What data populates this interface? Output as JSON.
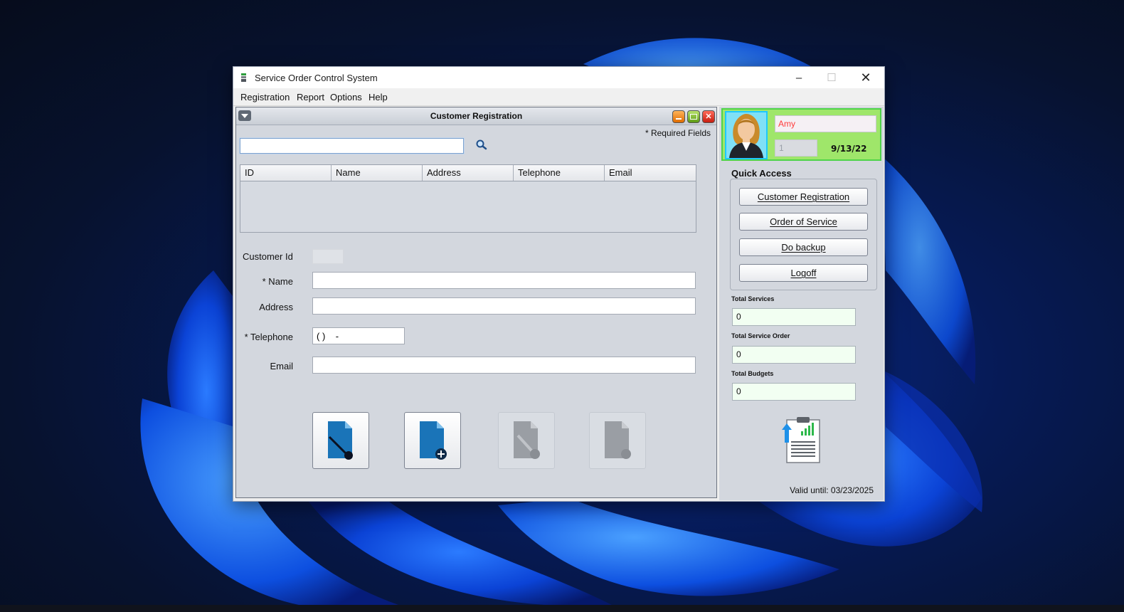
{
  "window": {
    "title": "Service Order Control System",
    "controls": {
      "minimize": "–",
      "maximize": "☐",
      "close": "✕"
    }
  },
  "menu": [
    "Registration",
    "Report",
    "Options",
    "Help"
  ],
  "form_window": {
    "title": "Customer Registration",
    "required_note": "* Required Fields",
    "search": {
      "value": "",
      "icon": "search-icon"
    },
    "table": {
      "columns": [
        "ID",
        "Name",
        "Address",
        "Telephone",
        "Email"
      ],
      "rows": []
    },
    "fields": {
      "customer_id": {
        "label": "Customer Id",
        "value": ""
      },
      "name": {
        "label": "* Name",
        "value": ""
      },
      "address": {
        "label": "Address",
        "value": ""
      },
      "telephone": {
        "label": "* Telephone",
        "value": "( )    -"
      },
      "email": {
        "label": "Email",
        "value": ""
      }
    },
    "actions": [
      {
        "icon": "clear-document-icon",
        "enabled": true
      },
      {
        "icon": "add-document-icon",
        "enabled": true
      },
      {
        "icon": "edit-document-icon",
        "enabled": false
      },
      {
        "icon": "delete-document-icon",
        "enabled": false
      }
    ]
  },
  "user": {
    "name": "Amy",
    "id": "1",
    "date": "9/13/22"
  },
  "quick_access": {
    "title": "Quick Access",
    "buttons": [
      "Customer Registration",
      "Order of Service",
      "Do backup",
      "Logoff"
    ]
  },
  "stats": [
    {
      "label": "Total Services",
      "value": "0"
    },
    {
      "label": "Total Service Order",
      "value": "0"
    },
    {
      "label": "Total Budgets",
      "value": "0"
    }
  ],
  "license": {
    "valid_until": "Valid until: 03/23/2025"
  },
  "colors": {
    "user_panel_bg": "#9fe66a",
    "user_panel_border": "#4fd34a",
    "user_name": "#ff3b3b",
    "avatar_border": "#1ec8ff",
    "stat_field_bg": "#f2fff2"
  }
}
